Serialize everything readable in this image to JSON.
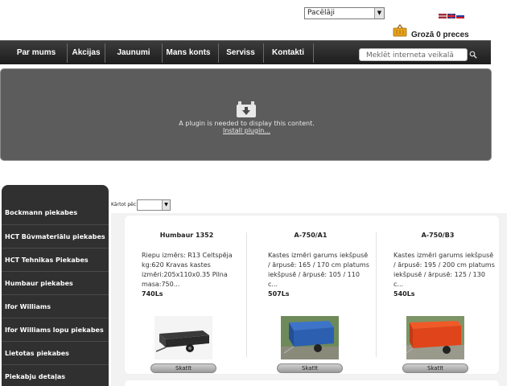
{
  "header": {
    "category_select": "Pacēlāji",
    "languages": [
      "Latviešu",
      "English",
      "Русский"
    ],
    "cart_text": "Grozā 0 preces"
  },
  "nav": {
    "items": [
      "Par mums",
      "Akcijas",
      "Jaunumi",
      "Mans konts",
      "Serviss",
      "Kontakti"
    ],
    "search_placeholder": "Meklēt interneta veikalā"
  },
  "plugin": {
    "message": "A plugin is needed to display this content.",
    "link": "Install plugin..."
  },
  "sidebar": {
    "items": [
      "Bockmann piekabes",
      "HCT Būvmateriālu piekabes",
      "HCT Tehnikas Piekabes",
      "Humbaur piekabes",
      "Ifor Williams",
      "Ifor Williams lopu piekabes",
      "Lietotas piekabes",
      "Piekabju detaļas"
    ]
  },
  "sort": {
    "label": "Kārtot pēc:",
    "value": ""
  },
  "products": [
    {
      "title": "Humbaur 1352",
      "description": "Riepu izmērs: R13 Celtspēja kg:620 Kravas kastes izmēri:205x110x0.35 Pilna masa:750...",
      "price": "740Ls",
      "button": "Skatīt",
      "image_colors": {
        "box": "#2a2a2a",
        "frame": "#555555"
      }
    },
    {
      "title": "A-750/A1",
      "description": "Kastes izmēri garums iekšpusē / ārpusē: 165 / 170 cm platums iekšpusē / ārpusē: 105 / 110 c...",
      "price": "507Ls",
      "button": "Skatīt",
      "image_colors": {
        "box": "#2c5fb0",
        "frame": "#7a7a7a"
      }
    },
    {
      "title": "A-750/B3",
      "description": "Kastes izmēri garums iekšpusē / ārpusē: 195 / 200 cm platums iekšpusē / ārpusē: 125 / 130 c...",
      "price": "540Ls",
      "button": "Skatīt",
      "image_colors": {
        "box": "#e0441a",
        "frame": "#7a7a7a"
      }
    }
  ]
}
